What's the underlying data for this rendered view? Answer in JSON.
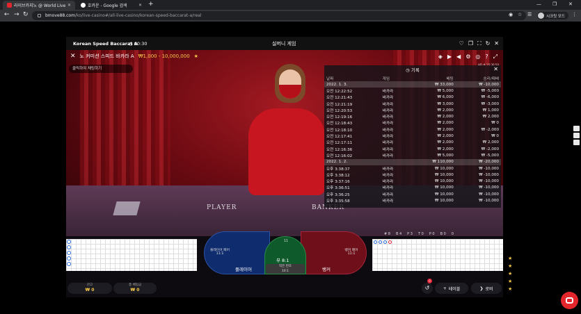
{
  "browser": {
    "tabs": [
      {
        "title": "라이브카지노 @ World Live | B",
        "active": true
      },
      {
        "title": "호카운 - Google 검색",
        "active": false
      }
    ],
    "url_host": "bmove88.com",
    "url_path": "/ko/live-casino#/all-live-casino/korean-speed-baccarat-a/real",
    "profile_label": "시크릿 모드"
  },
  "game": {
    "header_title": "Korean Speed Baccarat A",
    "header_time": "00:30",
    "header_center": "실머니 게임",
    "table_name": "노 커미션 스피드 바카라 A",
    "table_limit": "₩1,000 - 10,000,000",
    "chat_hint": "클릭하여 채팅하기",
    "hd_label": "HD # 15:30:50",
    "table_words": [
      "PLAYER",
      "BANKER"
    ]
  },
  "history": {
    "title": "기록",
    "columns": [
      "날짜",
      "게임",
      "베팅",
      "승리/패배"
    ],
    "rows": [
      {
        "type": "date",
        "date": "2022. 1. 3.",
        "game": "",
        "bet": "₩ 33,000",
        "result": "₩ -10,000"
      },
      {
        "type": "row",
        "date": "오전 12:22:52",
        "game": "바카라",
        "bet": "₩ 5,000",
        "result": "₩ -5,000"
      },
      {
        "type": "row",
        "date": "오전 12:21:43",
        "game": "바카라",
        "bet": "₩ 6,000",
        "result": "₩ -6,000"
      },
      {
        "type": "row",
        "date": "오전 12:21:19",
        "game": "바카라",
        "bet": "₩ 3,000",
        "result": "₩ -3,000"
      },
      {
        "type": "row",
        "date": "오전 12:20:53",
        "game": "바카라",
        "bet": "₩ 2,000",
        "result": "₩ 1,000"
      },
      {
        "type": "row",
        "date": "오전 12:19:16",
        "game": "바카라",
        "bet": "₩ 2,000",
        "result": "₩ 2,000"
      },
      {
        "type": "row",
        "date": "오전 12:18:43",
        "game": "바카라",
        "bet": "₩ 2,000",
        "result": "₩ 0"
      },
      {
        "type": "row",
        "date": "오전 12:18:10",
        "game": "바카라",
        "bet": "₩ 2,000",
        "result": "₩ -2,000"
      },
      {
        "type": "row",
        "date": "오전 12:17:41",
        "game": "바카라",
        "bet": "₩ 2,000",
        "result": "₩ 0"
      },
      {
        "type": "row",
        "date": "오전 12:17:11",
        "game": "바카라",
        "bet": "₩ 2,000",
        "result": "₩ 2,000"
      },
      {
        "type": "row",
        "date": "오전 12:16:36",
        "game": "바카라",
        "bet": "₩ 2,000",
        "result": "₩ -2,000"
      },
      {
        "type": "row",
        "date": "오전 12:16:02",
        "game": "바카라",
        "bet": "₩ 5,000",
        "result": "₩ -5,000"
      },
      {
        "type": "date",
        "date": "2022. 1. 2.",
        "game": "",
        "bet": "₩ 110,000",
        "result": "₩ -20,000"
      },
      {
        "type": "row",
        "date": "오후 3:38:37",
        "game": "바카라",
        "bet": "₩ 10,000",
        "result": "₩ -10,000"
      },
      {
        "type": "row",
        "date": "오후 3:38:12",
        "game": "바카라",
        "bet": "₩ 10,000",
        "result": "₩ -10,000"
      },
      {
        "type": "row",
        "date": "오후 3:37:16",
        "game": "바카라",
        "bet": "₩ 10,000",
        "result": "₩ -10,000"
      },
      {
        "type": "row",
        "date": "오후 3:36:51",
        "game": "바카라",
        "bet": "₩ 10,000",
        "result": "₩ -10,000"
      },
      {
        "type": "row",
        "date": "오후 3:36:25",
        "game": "바카라",
        "bet": "₩ 10,000",
        "result": "₩ -10,000"
      },
      {
        "type": "row",
        "date": "오후 3:35:58",
        "game": "바카라",
        "bet": "₩ 10,000",
        "result": "₩ -10,000"
      }
    ]
  },
  "betting": {
    "player_label": "플레이어",
    "player_pair": "플레이어 페어",
    "player_pair_odds": "11:1",
    "tie_label": "무 8:1",
    "tie_pair_odds": "11",
    "banker_label": "뱅커",
    "banker_pair": "뱅커 페어",
    "banker_pair_odds": "11:1",
    "side_bet": "작은 번호",
    "side_bet_odds": "10:1"
  },
  "stats": [
    "# 8",
    "B 4",
    "P 3",
    "T 0",
    "P 0",
    "B 0",
    "0"
  ],
  "wallet": {
    "balance_label": "잔고",
    "balance_value": "₩ 0",
    "totalbet_label": "총 베팅금",
    "totalbet_value": "₩ 0"
  },
  "controls": {
    "undo_badge": "0",
    "table_button": "테이블",
    "lobby_button": "로비"
  },
  "colors": {
    "accent_gold": "#f7c948",
    "player_blue": "#0f2c6e",
    "banker_red": "#6e0f1a",
    "tie_green": "#0f5a2a"
  }
}
